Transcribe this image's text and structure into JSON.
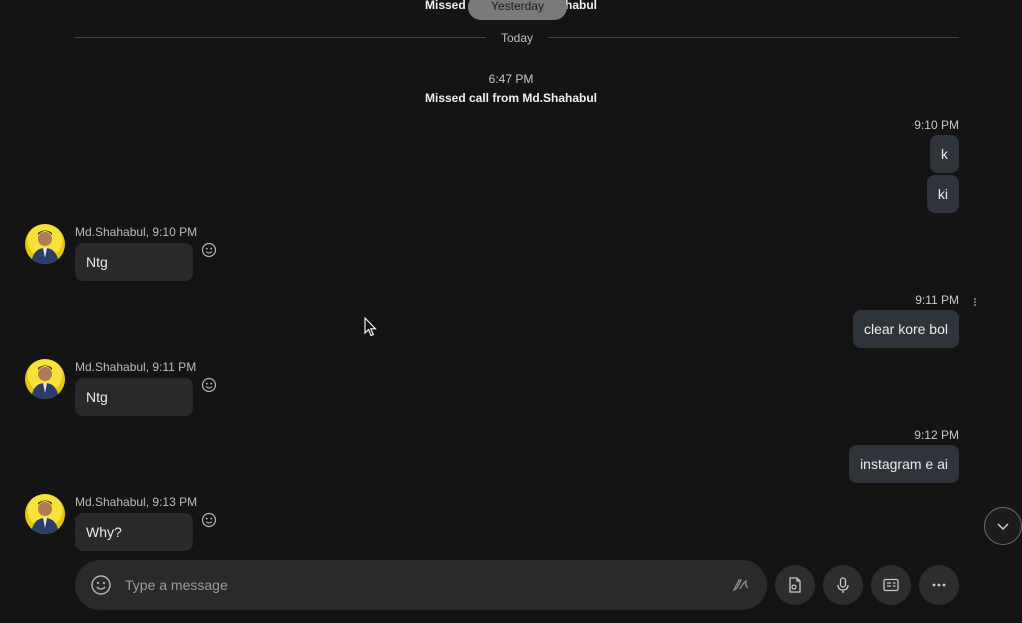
{
  "header": {
    "top_missed_call": "Missed call from Md.Shahabul",
    "yesterday_label": "Yesterday",
    "today_label": "Today",
    "system_time": "6:47 PM",
    "system_missed_call": "Missed call from Md.Shahabul"
  },
  "messages": {
    "out1": {
      "time": "9:10 PM",
      "texts": [
        "k",
        "ki"
      ]
    },
    "in1": {
      "sender": "Md.Shahabul, 9:10 PM",
      "text": "Ntg"
    },
    "out2": {
      "time": "9:11 PM",
      "text": "clear kore bol"
    },
    "in2": {
      "sender": "Md.Shahabul, 9:11 PM",
      "text": "Ntg"
    },
    "out3": {
      "time": "9:12 PM",
      "text": "instagram e ai"
    },
    "in3": {
      "sender": "Md.Shahabul, 9:13 PM",
      "text": "Why?"
    }
  },
  "composer": {
    "placeholder": "Type a message"
  },
  "colors": {
    "background": "#141414",
    "bubble_out": "#2e343a",
    "bubble_in": "#292929",
    "avatar_bg": "#f7e23a"
  },
  "icons": [
    "emoji-icon",
    "pen-icon",
    "file-icon",
    "mic-icon",
    "contact-card-icon",
    "more-icon",
    "chevron-down-icon",
    "more-vertical-icon"
  ]
}
